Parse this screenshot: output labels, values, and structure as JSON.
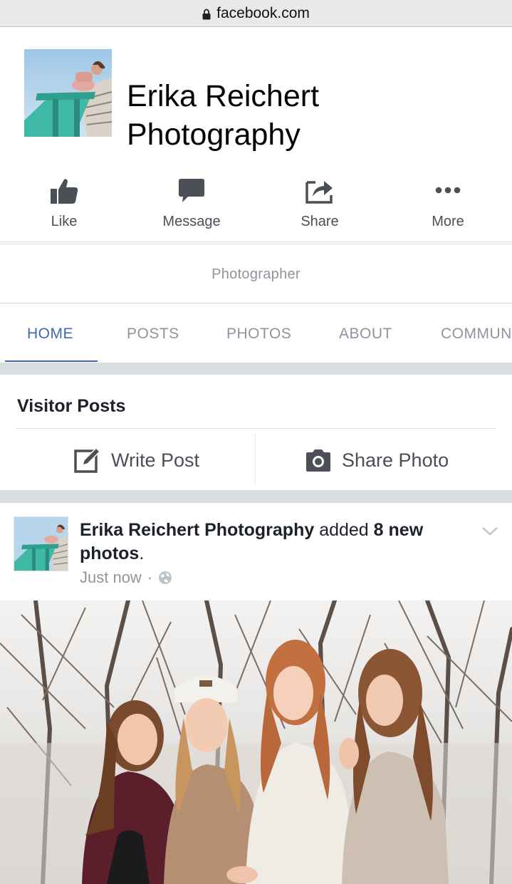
{
  "browser": {
    "url": "facebook.com"
  },
  "page": {
    "name_line1": "Erika Reichert",
    "name_line2": "Photography",
    "category": "Photographer"
  },
  "actions": [
    {
      "label": "Like",
      "icon": "thumbs-up-icon"
    },
    {
      "label": "Message",
      "icon": "message-bubble-icon"
    },
    {
      "label": "Share",
      "icon": "share-arrow-icon"
    },
    {
      "label": "More",
      "icon": "more-dots-icon"
    }
  ],
  "tabs": [
    {
      "label": "HOME",
      "active": true
    },
    {
      "label": "POSTS",
      "active": false
    },
    {
      "label": "PHOTOS",
      "active": false
    },
    {
      "label": "ABOUT",
      "active": false
    },
    {
      "label": "COMMUNITY",
      "active": false
    }
  ],
  "visitor_posts": {
    "title": "Visitor Posts",
    "write_label": "Write Post",
    "share_photo_label": "Share Photo"
  },
  "post": {
    "author": "Erika Reichert Photography",
    "action_text": " added ",
    "count_text": "8 new photos",
    "end": ".",
    "timestamp": "Just now",
    "separator": "·",
    "privacy_icon": "globe-icon"
  },
  "colors": {
    "accent": "#4267b2",
    "icon_gray": "#4b4f56",
    "muted": "#8d949e",
    "divider_band": "#dadde1"
  }
}
